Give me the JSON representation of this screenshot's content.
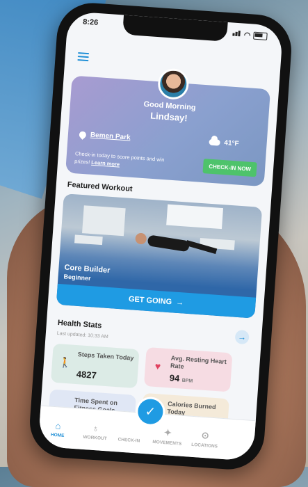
{
  "status": {
    "time": "8:26"
  },
  "hero": {
    "greeting": "Good Morning",
    "name": "Lindsay!",
    "location": "Bemen Park",
    "temperature": "41°F",
    "checkin_text": "Check-in today to score points and win prizes!",
    "learn_more": "Learn more",
    "checkin_button": "CHECK-IN NOW"
  },
  "featured": {
    "section_title": "Featured Workout",
    "workout_title": "Core Builder",
    "workout_level": "Beginner",
    "cta": "GET GOING"
  },
  "health": {
    "section_title": "Health Stats",
    "updated": "Last updated: 10:33 AM",
    "cards": [
      {
        "label": "Steps Taken Today",
        "value": "4827",
        "unit": ""
      },
      {
        "label": "Avg. Resting Heart Rate",
        "value": "94",
        "unit": "BPM"
      },
      {
        "label": "Time Spent on Fitness Goals",
        "value": "",
        "unit": ""
      },
      {
        "label": "Calories Burned Today",
        "value": "",
        "unit": ""
      }
    ]
  },
  "tabs": [
    {
      "label": "HOME",
      "icon": "home-icon"
    },
    {
      "label": "WORKOUT",
      "icon": "workout-icon"
    },
    {
      "label": "CHECK-IN",
      "icon": "checkin-icon"
    },
    {
      "label": "MOVEMENTS",
      "icon": "movements-icon"
    },
    {
      "label": "LOCATIONS",
      "icon": "locations-icon"
    }
  ],
  "colors": {
    "accent": "#1f9be3",
    "checkin_green": "#4ec36b"
  }
}
